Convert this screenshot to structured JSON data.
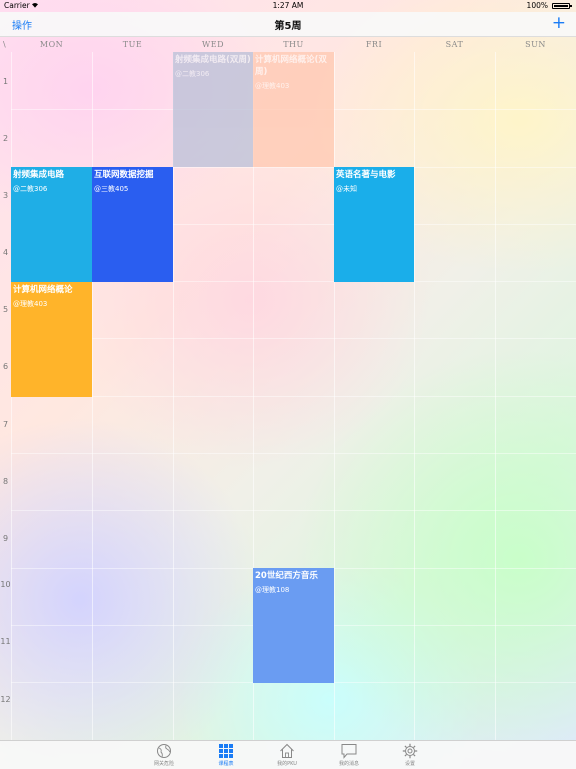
{
  "status_bar": {
    "carrier": "Carrier",
    "time": "1:27 AM",
    "battery": "100%"
  },
  "nav": {
    "left_button": "操作",
    "title": "第5周",
    "right_button": "+"
  },
  "corner_label": "\\",
  "days": [
    "MON",
    "TUE",
    "WED",
    "THU",
    "FRI",
    "SAT",
    "SUN"
  ],
  "periods": [
    "1",
    "2",
    "3",
    "4",
    "5",
    "6",
    "7",
    "8",
    "9",
    "10",
    "11",
    "12"
  ],
  "courses": [
    {
      "title": "射频集成电路(双周)",
      "location": "@二教306",
      "color": "#b9c0d8"
    },
    {
      "title": "计算机网络概论(双周)",
      "location": "@理教403",
      "color": "#ffc8b0"
    },
    {
      "title": "射频集成电路",
      "location": "@二教306",
      "color": "#1faee6"
    },
    {
      "title": "互联网数据挖掘",
      "location": "@三教405",
      "color": "#2a5ef0"
    },
    {
      "title": "英语名著与电影",
      "location": "@未知",
      "color": "#1aaeea"
    },
    {
      "title": "计算机网络概论",
      "location": "@理教403",
      "color": "#ffb42a"
    },
    {
      "title": "20世纪西方音乐",
      "location": "@理教108",
      "color": "#6a9cf2"
    }
  ],
  "tabs": [
    {
      "label": "网关危险",
      "icon": "globe-icon",
      "active": false
    },
    {
      "label": "课程表",
      "icon": "grid-icon",
      "active": true
    },
    {
      "label": "我的PKU",
      "icon": "home-icon",
      "active": false
    },
    {
      "label": "我的消息",
      "icon": "chat-icon",
      "active": false
    },
    {
      "label": "设置",
      "icon": "gear-icon",
      "active": false
    }
  ],
  "colors": {
    "accent": "#1a7cf5"
  }
}
